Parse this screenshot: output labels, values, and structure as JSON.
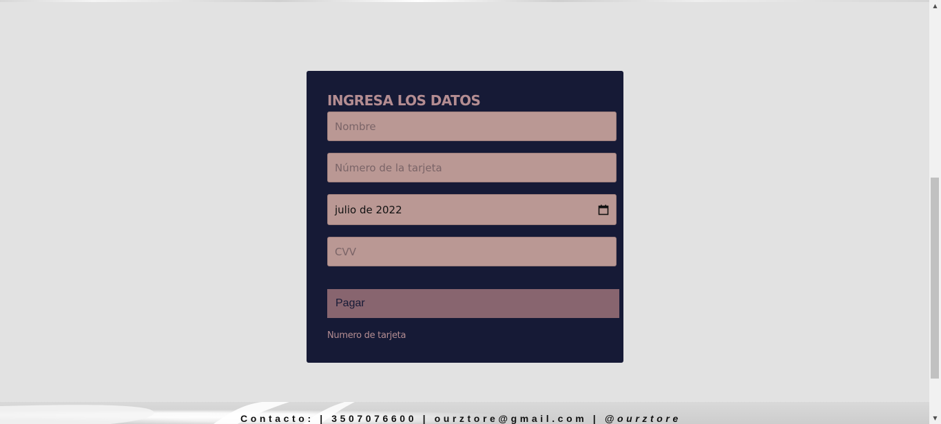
{
  "form": {
    "title": "INGRESA LOS DATOS",
    "name_placeholder": "Nombre",
    "card_placeholder": "Número de la tarjeta",
    "date_value": "julio de 2022",
    "cvv_placeholder": "CVV",
    "pay_label": "Pagar",
    "hint": "Numero de tarjeta"
  },
  "footer": {
    "contact_text": "Contacto: | 3507076600 | ourztore@gmail.com |",
    "handle": "@ourztore"
  },
  "icons": {
    "date_picker": "calendar-icon",
    "scroll_up": "chevron-up-icon",
    "scroll_down": "chevron-down-icon"
  },
  "colors": {
    "page_background": "#e2e2e2",
    "card_background": "#161a36",
    "accent_text": "#b48d92",
    "field_background": "#ba9894",
    "button_background": "#88656f"
  }
}
